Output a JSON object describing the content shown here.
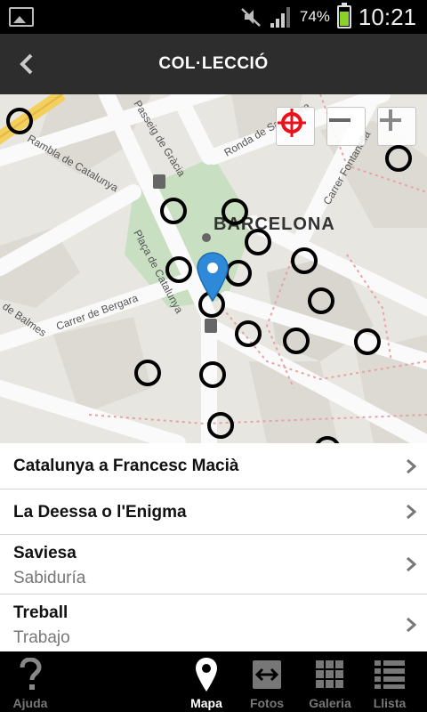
{
  "status_bar": {
    "battery_percent": "74%",
    "battery_level": 0.74,
    "time": "10:21",
    "icons": [
      "picture-icon",
      "mute-icon",
      "signal-icon",
      "battery-icon"
    ]
  },
  "action_bar": {
    "title": "COL·LECCIÓ"
  },
  "map": {
    "city_label": "BARCELONA",
    "streets": [
      "Rambla de Catalunya",
      "Passeig de Gràcia",
      "Ronda de Sant Pere",
      "Carrer Fontanella",
      "Plaça de Catalunya",
      "Carrer de Bergara",
      "de Balmes"
    ],
    "controls": [
      "locate-icon",
      "zoom-out-icon",
      "zoom-in-icon"
    ],
    "colors": {
      "marker": "#2e8ad8",
      "locate": "#e8121b",
      "park": "#c8dfc1"
    }
  },
  "list": {
    "items": [
      {
        "title": "Catalunya a Francesc Macià",
        "subtitle": ""
      },
      {
        "title": "La Deessa o l'Enigma",
        "subtitle": ""
      },
      {
        "title": "Saviesa",
        "subtitle": "Sabiduría"
      },
      {
        "title": "Treball",
        "subtitle": "Trabajo"
      }
    ]
  },
  "bottom_nav": {
    "active": "Mapa",
    "items": [
      {
        "label": "Ajuda",
        "icon": "help-icon"
      },
      {
        "label": "Mapa",
        "icon": "map-pin-icon"
      },
      {
        "label": "Fotos",
        "icon": "swap-icon"
      },
      {
        "label": "Galeria",
        "icon": "grid-icon"
      },
      {
        "label": "Llista",
        "icon": "list-icon"
      }
    ]
  }
}
